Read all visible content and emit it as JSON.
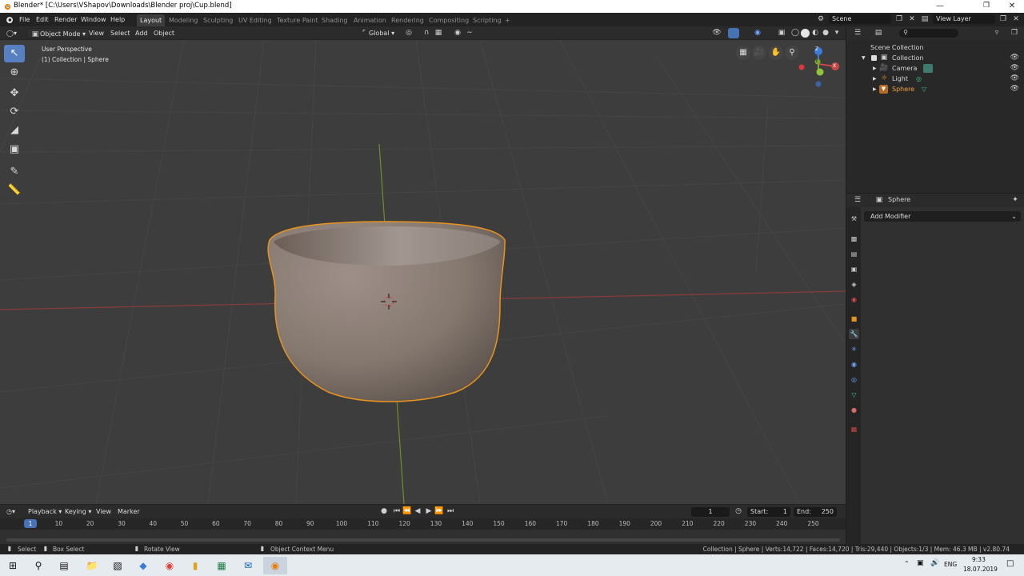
{
  "window": {
    "title": "Blender* [C:\\Users\\VShapov\\Downloads\\Blender proj\\Cup.blend]",
    "minimize": "—",
    "maximize": "❐",
    "close": "✕"
  },
  "menus": [
    "File",
    "Edit",
    "Render",
    "Window",
    "Help"
  ],
  "workspaces": [
    {
      "label": "Layout",
      "active": true
    },
    {
      "label": "Modeling"
    },
    {
      "label": "Sculpting"
    },
    {
      "label": "UV Editing"
    },
    {
      "label": "Texture Paint"
    },
    {
      "label": "Shading"
    },
    {
      "label": "Animation"
    },
    {
      "label": "Rendering"
    },
    {
      "label": "Compositing"
    },
    {
      "label": "Scripting"
    }
  ],
  "add_workspace": "+",
  "scene": {
    "label": "Scene",
    "view_layer": "View Layer"
  },
  "viewport_header": {
    "mode": "Object Mode",
    "menus": [
      "View",
      "Select",
      "Add",
      "Object"
    ],
    "transform_orientation": "Global"
  },
  "viewport": {
    "perspective_label": "User Perspective",
    "collection_label": "(1) Collection | Sphere",
    "gizmo": {
      "x": "X",
      "y": "Y",
      "z": "Z"
    }
  },
  "outliner": {
    "search_placeholder": "",
    "items": [
      {
        "label": "Scene Collection"
      },
      {
        "label": "Collection"
      },
      {
        "label": "Camera"
      },
      {
        "label": "Light"
      },
      {
        "label": "Sphere",
        "selected": true
      }
    ]
  },
  "properties": {
    "object_name": "Sphere",
    "add_modifier": "Add Modifier"
  },
  "timeline": {
    "menus": [
      "Playback",
      "Keying",
      "View",
      "Marker"
    ],
    "current_frame": "1",
    "start_label": "Start:",
    "start": "1",
    "end_label": "End:",
    "end": "250",
    "ruler": [
      "1",
      "10",
      "20",
      "30",
      "40",
      "50",
      "60",
      "70",
      "80",
      "90",
      "100",
      "110",
      "120",
      "130",
      "140",
      "150",
      "160",
      "170",
      "180",
      "190",
      "200",
      "210",
      "220",
      "230",
      "240",
      "250"
    ]
  },
  "statusbar": {
    "select": "Select",
    "box_select": "Box Select",
    "rotate_view": "Rotate View",
    "context_menu": "Object Context Menu",
    "stats": "Collection | Sphere | Verts:14,722 | Faces:14,720 | Tris:29,440 | Objects:1/3 | Mem: 46.3 MB | v2.80.74"
  },
  "taskbar": {
    "time": "9:33",
    "date": "18.07.2019",
    "lang": "ENG"
  },
  "colors": {
    "accent": "#4772b3",
    "selection_outline": "#e8931e",
    "x_axis": "#9a3b3b",
    "y_axis": "#6a8e22"
  }
}
